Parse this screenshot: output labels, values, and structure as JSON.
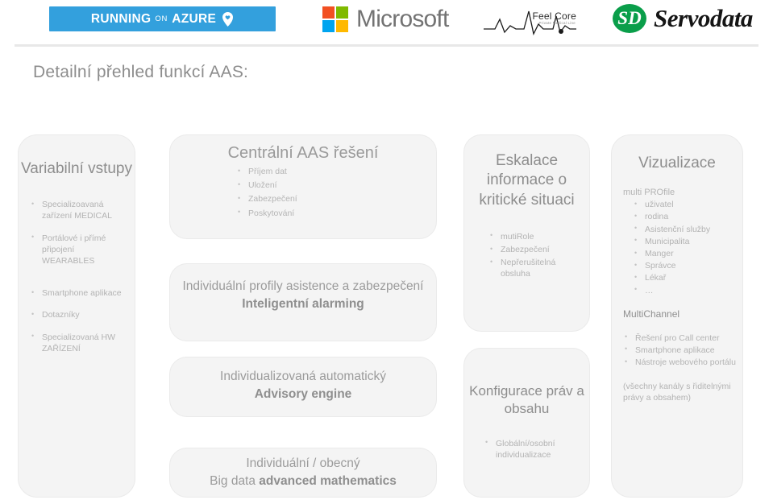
{
  "header": {
    "azure_badge": {
      "word1": "RUNNING",
      "word2": "ON",
      "word3": "AZURE",
      "bg_color": "#33a0dd",
      "pin_icon": "location-pin-heart-icon"
    },
    "microsoft": {
      "wordmark": "Microsoft",
      "square_colors": [
        "#f25022",
        "#7fba00",
        "#00a4ef",
        "#ffb900"
      ]
    },
    "feelcore": {
      "name": "Feel Core",
      "tagline": "Private Medical Line",
      "icon": "ecg-heartbeat-icon"
    },
    "servodata": {
      "mark": "SD",
      "wordmark": "Servodata",
      "color": "#0a9e4a"
    }
  },
  "title": "Detailní přehled funkcí AAS:",
  "columns": {
    "inputs": {
      "title": "Variabilní vstupy",
      "items": [
        "Specializoavaná zařízení MEDICAL",
        "Portálové i přímé připojení WEARABLES",
        "Smartphone aplikace",
        "Dotazníky",
        "Specializovaná HW ZAŘÍZENÍ"
      ]
    },
    "center": {
      "central_solution": {
        "title": "Centrální AAS řešení",
        "items": [
          "Příjem dat",
          "Uložení",
          "Zabezpečení",
          "Poskytování"
        ]
      },
      "profiles": {
        "line1": "Individuální profily asistence a zabezpečení",
        "line2": "Inteligentní alarming"
      },
      "advisory": {
        "line1": "Individualizovaná automatický",
        "line2": "Advisory engine"
      },
      "bigdata": {
        "line1": "Individuální / obecný",
        "line2_normal": "Big data ",
        "line2_bold": "advanced mathematics"
      }
    },
    "escalation": {
      "title": "Eskalace informace o kritické situaci",
      "items": [
        "mutiRole",
        "Zabezpečení",
        "Nepřerušitelná obsluha"
      ]
    },
    "configuration": {
      "title": "Konfigurace práv a obsahu",
      "items": [
        "Globální/osobní individualizace"
      ]
    },
    "visualization": {
      "title": "Vizualizace",
      "profiles_heading": "multi PROfile",
      "profiles": [
        "uživatel",
        "rodina",
        "Asistenční služby",
        "Municipalita",
        "Manger",
        "Správce",
        "Lékař",
        "…"
      ],
      "channels_heading": "MultiChannel",
      "channels": [
        "Řešení pro Call center",
        "Smartphone aplikace",
        "Nástroje webového portálu"
      ],
      "note": "(všechny kanály s řiditelnými právy a obsahem)"
    }
  }
}
